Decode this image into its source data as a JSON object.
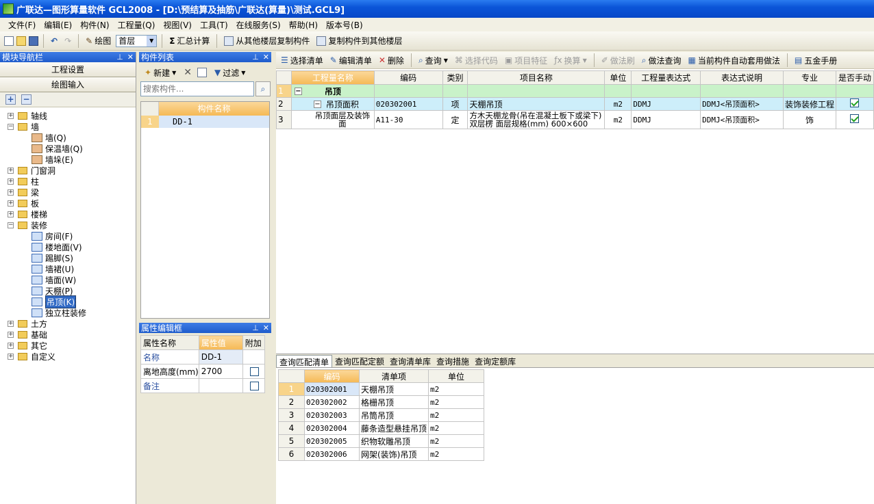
{
  "window": {
    "title": "广联达—图形算量软件 GCL2008 - [D:\\预结算及抽筋\\广联达(算量)\\测试.GCL9]"
  },
  "menu": [
    "文件(F)",
    "编辑(E)",
    "构件(N)",
    "工程量(Q)",
    "视图(V)",
    "工具(T)",
    "在线服务(S)",
    "帮助(H)",
    "版本号(B)"
  ],
  "toolbar": {
    "draw_label": "绘图",
    "floor_value": "首层",
    "sum_label": "汇总计算",
    "copy_from_label": "从其他楼层复制构件",
    "copy_to_label": "复制构件到其他楼层"
  },
  "nav": {
    "title": "模块导航栏",
    "tab_project": "工程设置",
    "tab_draw": "绘图输入",
    "tree": [
      {
        "label": "轴线",
        "expanded": false,
        "level": 0
      },
      {
        "label": "墙",
        "expanded": true,
        "level": 0
      },
      {
        "label": "墙(Q)",
        "level": 1
      },
      {
        "label": "保温墙(Q)",
        "level": 1
      },
      {
        "label": "墙垛(E)",
        "level": 1
      },
      {
        "label": "门窗洞",
        "expanded": false,
        "level": 0
      },
      {
        "label": "柱",
        "expanded": false,
        "level": 0
      },
      {
        "label": "梁",
        "expanded": false,
        "level": 0
      },
      {
        "label": "板",
        "expanded": false,
        "level": 0
      },
      {
        "label": "楼梯",
        "expanded": false,
        "level": 0
      },
      {
        "label": "装修",
        "expanded": true,
        "level": 0
      },
      {
        "label": "房间(F)",
        "level": 1
      },
      {
        "label": "楼地面(V)",
        "level": 1
      },
      {
        "label": "踢脚(S)",
        "level": 1
      },
      {
        "label": "墙裙(U)",
        "level": 1
      },
      {
        "label": "墙面(W)",
        "level": 1
      },
      {
        "label": "天棚(P)",
        "level": 1
      },
      {
        "label": "吊顶(K)",
        "level": 1,
        "selected": true
      },
      {
        "label": "独立柱装修",
        "level": 1
      },
      {
        "label": "土方",
        "expanded": false,
        "level": 0
      },
      {
        "label": "基础",
        "expanded": false,
        "level": 0
      },
      {
        "label": "其它",
        "expanded": false,
        "level": 0
      },
      {
        "label": "自定义",
        "expanded": false,
        "level": 0
      }
    ]
  },
  "complist": {
    "title": "构件列表",
    "new_label": "新建",
    "filter_label": "过滤",
    "search_placeholder": "搜索构件...",
    "header": "构件名称",
    "rows": [
      {
        "num": "1",
        "name": "DD-1"
      }
    ]
  },
  "propedit": {
    "title": "属性编辑框",
    "headers": [
      "属性名称",
      "属性值",
      "附加"
    ],
    "rows": [
      {
        "name": "名称",
        "value": "DD-1",
        "extra": ""
      },
      {
        "name": "离地高度(mm)",
        "value": "2700",
        "extra": "checkbox"
      },
      {
        "name": "备注",
        "value": "",
        "extra": "checkbox"
      }
    ]
  },
  "main_toolbar": {
    "select_list": "选择清单",
    "edit_list": "编辑清单",
    "delete": "删除",
    "query": "查询",
    "select_code": "选择代码",
    "item_feature": "项目特征",
    "convert": "换算",
    "method_brush": "做法刷",
    "method_query": "做法查询",
    "auto_apply": "当前构件自动套用做法",
    "hardware": "五金手册"
  },
  "grid": {
    "headers": [
      "工程量名称",
      "编码",
      "类别",
      "项目名称",
      "单位",
      "工程量表达式",
      "表达式说明",
      "专业",
      "是否手动"
    ],
    "rows": [
      {
        "num": "1",
        "name": "吊顶",
        "code": "",
        "type": "",
        "item": "",
        "unit": "",
        "expr": "",
        "expr_desc": "",
        "major": "",
        "manual": ""
      },
      {
        "num": "2",
        "name": "吊顶面积",
        "code": "020302001",
        "type": "项",
        "item": "天棚吊顶",
        "unit": "m2",
        "expr": "DDMJ",
        "expr_desc": "DDMJ<吊顶面积>",
        "major": "装饰装修工程",
        "manual": "checked"
      },
      {
        "num": "3",
        "name": "吊顶面层及装饰面",
        "code": "A11-30",
        "type": "定",
        "item": "方木天棚龙骨(吊在混凝土板下或梁下) 双层楞 面层规格(mm) 600×600",
        "unit": "m2",
        "expr": "DDMJ",
        "expr_desc": "DDMJ<吊顶面积>",
        "major": "饰",
        "manual": "checked"
      }
    ]
  },
  "bottom_tabs": [
    "查询匹配清单",
    "查询匹配定额",
    "查询清单库",
    "查询措施",
    "查询定额库"
  ],
  "query_table": {
    "headers": [
      "编码",
      "清单项",
      "单位"
    ],
    "rows": [
      {
        "num": "1",
        "code": "020302001",
        "name": "天棚吊顶",
        "unit": "m2"
      },
      {
        "num": "2",
        "code": "020302002",
        "name": "格栅吊顶",
        "unit": "m2"
      },
      {
        "num": "3",
        "code": "020302003",
        "name": "吊筒吊顶",
        "unit": "m2"
      },
      {
        "num": "4",
        "code": "020302004",
        "name": "藤条造型悬挂吊顶",
        "unit": "m2"
      },
      {
        "num": "5",
        "code": "020302005",
        "name": "织物软雕吊顶",
        "unit": "m2"
      },
      {
        "num": "6",
        "code": "020302006",
        "name": "网架(装饰)吊顶",
        "unit": "m2"
      }
    ]
  }
}
